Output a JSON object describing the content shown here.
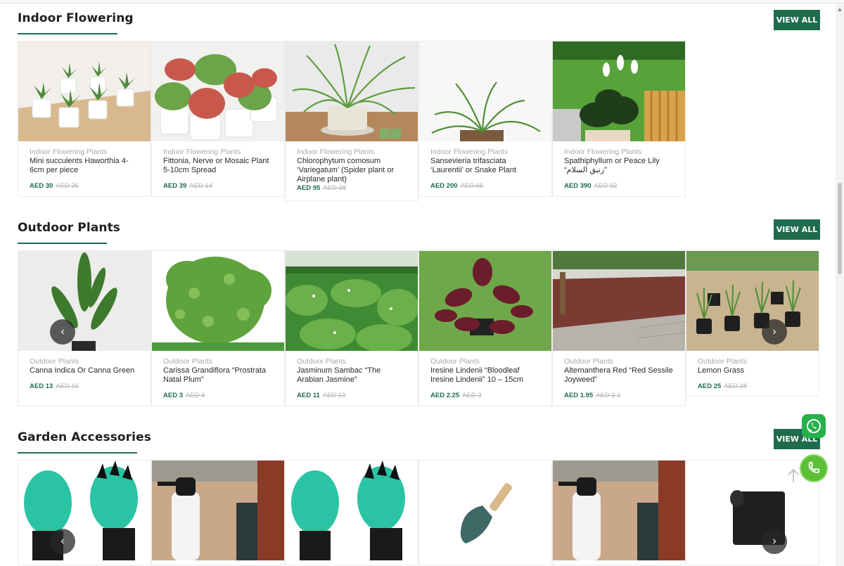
{
  "sections": [
    {
      "title": "Indoor Flowering",
      "view_all": "VIEW ALL",
      "products": [
        {
          "category": "Indoor Flowering Plants",
          "name": "Mini succulents Haworthia 4-6cm per piece",
          "price": "AED 30",
          "old_price": "AED 35"
        },
        {
          "category": "Indoor Flowering Plants",
          "name": "Fittonia, Nerve or Mosaic Plant 5-10cm Spread",
          "price": "AED 39",
          "old_price": "AED 14"
        },
        {
          "category": "Indoor Flowering Plants",
          "name": "Chlorophytum comosum ‘Variegatum’ (Spider plant or Airplane plant)",
          "price": "AED 95",
          "old_price": "AED 38"
        },
        {
          "category": "Indoor Flowering Plants",
          "name": "Sansevieria trifasciata ‘Laurentii’ or Snake Plant",
          "price": "AED 200",
          "old_price": "AED 65"
        },
        {
          "category": "Indoor Flowering Plants",
          "name": "Spathiphyllum or Peace Lily “زنبق السلام”",
          "price": "AED 390",
          "old_price": "AED 32"
        }
      ]
    },
    {
      "title": "Outdoor Plants",
      "view_all": "VIEW ALL",
      "products": [
        {
          "category": "Outdoor Plants",
          "name": "Canna Indica Or Canna Green",
          "price": "AED 13",
          "old_price": "AED 15"
        },
        {
          "category": "Outdoor Plants",
          "name": "Carissa Grandiflora “Prostrata Natal Plum”",
          "price": "AED 3",
          "old_price": "AED 4"
        },
        {
          "category": "Outdoor Plants",
          "name": "Jasminum Sambac “The Arabian Jasmine”",
          "price": "AED 11",
          "old_price": "AED 13"
        },
        {
          "category": "Outdoor Plants",
          "name": "Iresine Lindenii “Bloodleaf Iresine Lindenii” 10 – 15cm",
          "price": "AED 2.25",
          "old_price": "AED 3"
        },
        {
          "category": "Outdoor Plants",
          "name": "Alternanthera Red “Red Sessile Joyweed”",
          "price": "AED 1.95",
          "old_price": "AED 2.1"
        },
        {
          "category": "Outdoor Plants",
          "name": "Lemon Grass",
          "price": "AED 25",
          "old_price": "AED 28"
        }
      ]
    },
    {
      "title": "Garden Accessories",
      "view_all": "VIEW ALL",
      "products": [
        {
          "image": "garden-gloves"
        },
        {
          "image": "pressure-sprayer"
        },
        {
          "image": "garden-gloves"
        },
        {
          "image": "hand-trowel"
        },
        {
          "image": "pressure-sprayer"
        },
        {
          "image": "black-edging-roll"
        }
      ]
    }
  ],
  "carousel": {
    "prev_icon": "‹",
    "next_icon": "›"
  },
  "colors": {
    "brand_green": "#1f6b4e",
    "price_green": "#1f6b4e",
    "whatsapp_green": "#25b04a",
    "call_green": "#5cbf36"
  }
}
